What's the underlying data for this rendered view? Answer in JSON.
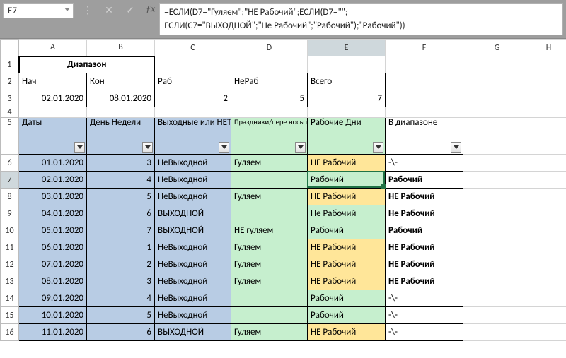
{
  "active_cell": "E7",
  "formula_text": "=ЕСЛИ(D7=\"Гуляем\";\"НЕ Рабочий\";ЕСЛИ(D7=\"\";\nЕСЛИ(C7=\"ВЫХОДНОЙ\";\"Не Рабочий\";\"Рабочий\");\"Рабочий\"))",
  "columns": [
    "A",
    "B",
    "C",
    "D",
    "E",
    "F",
    "G",
    "H"
  ],
  "row_labels": [
    "1",
    "2",
    "3",
    "4",
    "5",
    "6",
    "7",
    "8",
    "9",
    "10",
    "11",
    "12",
    "13",
    "14",
    "15",
    "16"
  ],
  "header1": {
    "diapazon": "Диапазон"
  },
  "header2": {
    "nach": "Нач",
    "kon": "Кон",
    "rab": "Раб",
    "nerab": "НеРаб",
    "vsego": "Всего"
  },
  "header3": {
    "nach_val": "02.01.2020",
    "kon_val": "08.01.2020",
    "rab_val": "2",
    "nerab_val": "5",
    "vsego_val": "7"
  },
  "table_header": {
    "A": "Даты",
    "B": "День Недели",
    "C": "Выходные или НЕТ",
    "D": "Праздники/пере носы или пуст",
    "E": "Рабочие Дни",
    "F": "В диапазоне"
  },
  "rows": [
    {
      "r": "6",
      "A": "01.01.2020",
      "B": "3",
      "C": "НеВыходной",
      "D": "Гуляем",
      "E": "НЕ Рабочий",
      "F": "-\\-"
    },
    {
      "r": "7",
      "A": "02.01.2020",
      "B": "4",
      "C": "НеВыходной",
      "D": "",
      "E": "Рабочий",
      "F": "Рабочий"
    },
    {
      "r": "8",
      "A": "03.01.2020",
      "B": "5",
      "C": "НеВыходной",
      "D": "Гуляем",
      "E": "НЕ Рабочий",
      "F": "НЕ Рабочий"
    },
    {
      "r": "9",
      "A": "04.01.2020",
      "B": "6",
      "C": "ВЫХОДНОЙ",
      "D": "",
      "E": "Не Рабочий",
      "F": "Не Рабочий"
    },
    {
      "r": "10",
      "A": "05.01.2020",
      "B": "7",
      "C": "ВЫХОДНОЙ",
      "D": "НЕ гуляем",
      "E": "Рабочий",
      "F": "Рабочий"
    },
    {
      "r": "11",
      "A": "06.01.2020",
      "B": "1",
      "C": "НеВыходной",
      "D": "Гуляем",
      "E": "НЕ Рабочий",
      "F": "НЕ Рабочий"
    },
    {
      "r": "12",
      "A": "07.01.2020",
      "B": "2",
      "C": "НеВыходной",
      "D": "Гуляем",
      "E": "НЕ Рабочий",
      "F": "НЕ Рабочий"
    },
    {
      "r": "13",
      "A": "08.01.2020",
      "B": "3",
      "C": "НеВыходной",
      "D": "Гуляем",
      "E": "НЕ Рабочий",
      "F": "НЕ Рабочий"
    },
    {
      "r": "14",
      "A": "09.01.2020",
      "B": "4",
      "C": "НеВыходной",
      "D": "",
      "E": "Рабочий",
      "F": "-\\-"
    },
    {
      "r": "15",
      "A": "10.01.2020",
      "B": "5",
      "C": "НеВыходной",
      "D": "",
      "E": "Рабочий",
      "F": "-\\-"
    },
    {
      "r": "16",
      "A": "11.01.2020",
      "B": "6",
      "C": "ВЫХОДНОЙ",
      "D": "Гуляем",
      "E": "НЕ Рабочий",
      "F": "-\\-"
    }
  ],
  "icons": {
    "cancel": "✕",
    "accept": "✓",
    "dots": "⋮"
  }
}
